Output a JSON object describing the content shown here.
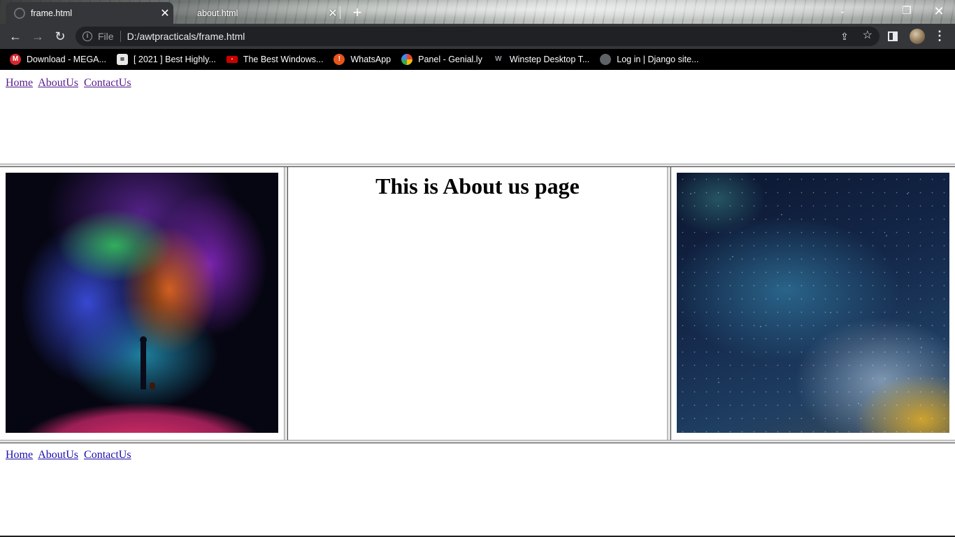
{
  "browser": {
    "tabs": [
      {
        "title": "frame.html",
        "active": true
      },
      {
        "title": "about.html",
        "active": false
      }
    ],
    "new_tab_symbol": "+",
    "address": {
      "scheme_label": "File",
      "url": "D:/awtpracticals/frame.html"
    },
    "bookmarks": [
      {
        "label": "Download - MEGA...",
        "icon": "mega-icon"
      },
      {
        "label": "[ 2021 ] Best Highly...",
        "icon": "site-thumbnail-icon"
      },
      {
        "label": "The Best Windows...",
        "icon": "hub-icon"
      },
      {
        "label": "WhatsApp",
        "icon": "alert-circle-icon"
      },
      {
        "label": "Panel - Genial.ly",
        "icon": "google-icon"
      },
      {
        "label": "Winstep Desktop T...",
        "icon": "winstep-icon"
      },
      {
        "label": "Log in | Django site...",
        "icon": "globe-icon"
      }
    ],
    "accent_colors": {
      "tab_active": "#35363a",
      "bookmarks_bar": "#000000",
      "omnibox": "#202124"
    }
  },
  "page": {
    "top_nav": {
      "home": "Home",
      "about": "AboutUs",
      "contact": "ContactUs"
    },
    "center_heading": "This is About us page",
    "bottom_nav": {
      "home": "Home",
      "about": "AboutUs",
      "contact": "ContactUs"
    },
    "link_colors": {
      "visited": "#551a8b",
      "unvisited": "#1a0dab"
    }
  }
}
